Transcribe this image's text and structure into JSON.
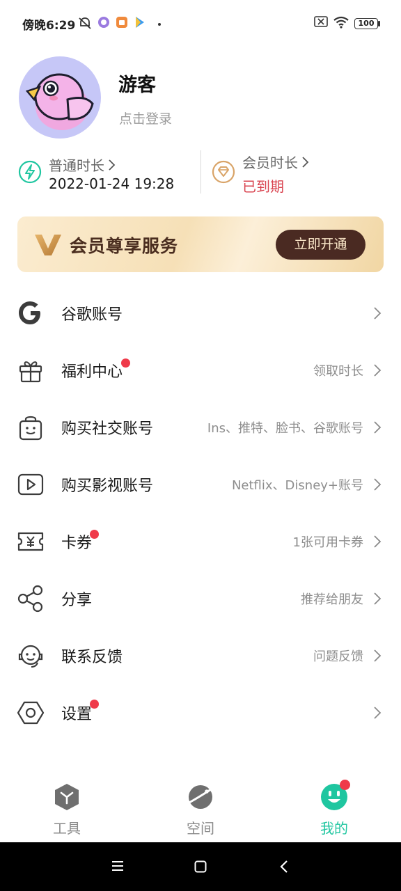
{
  "status_bar": {
    "time": "傍晚6:29",
    "battery": "100"
  },
  "profile": {
    "username": "游客",
    "login_hint": "点击登录"
  },
  "durations": {
    "normal_label": "普通时长",
    "normal_value": "2022-01-24 19:28",
    "vip_label": "会员时长",
    "vip_value": "已到期",
    "vip_value_color": "#d9434f"
  },
  "vip_banner": {
    "title": "会员尊享服务",
    "button": "立即开通"
  },
  "menu": [
    {
      "label": "谷歌账号",
      "sub": "",
      "icon": "google-icon",
      "dot": false
    },
    {
      "label": "福利中心",
      "sub": "领取时长",
      "icon": "gift-icon",
      "dot": true
    },
    {
      "label": "购买社交账号",
      "sub": "Ins、推特、脸书、谷歌账号",
      "icon": "shopping-bag-icon",
      "dot": false
    },
    {
      "label": "购买影视账号",
      "sub": "Netflix、Disney+账号",
      "icon": "video-play-icon",
      "dot": false
    },
    {
      "label": "卡券",
      "sub": "1张可用卡券",
      "icon": "coupon-icon",
      "dot": true
    },
    {
      "label": "分享",
      "sub": "推荐给朋友",
      "icon": "share-icon",
      "dot": false
    },
    {
      "label": "联系反馈",
      "sub": "问题反馈",
      "icon": "headset-icon",
      "dot": false
    },
    {
      "label": "设置",
      "sub": "",
      "icon": "settings-hexagon-icon",
      "dot": true
    }
  ],
  "bottom_nav": [
    {
      "label": "工具",
      "icon": "tools-cube-icon",
      "active": false
    },
    {
      "label": "空间",
      "icon": "planet-icon",
      "active": false
    },
    {
      "label": "我的",
      "icon": "smiley-profile-icon",
      "active": true
    }
  ],
  "colors": {
    "accent": "#1fc6a0",
    "badge": "#ef3a4a",
    "vip_button": "#4a2a22"
  }
}
